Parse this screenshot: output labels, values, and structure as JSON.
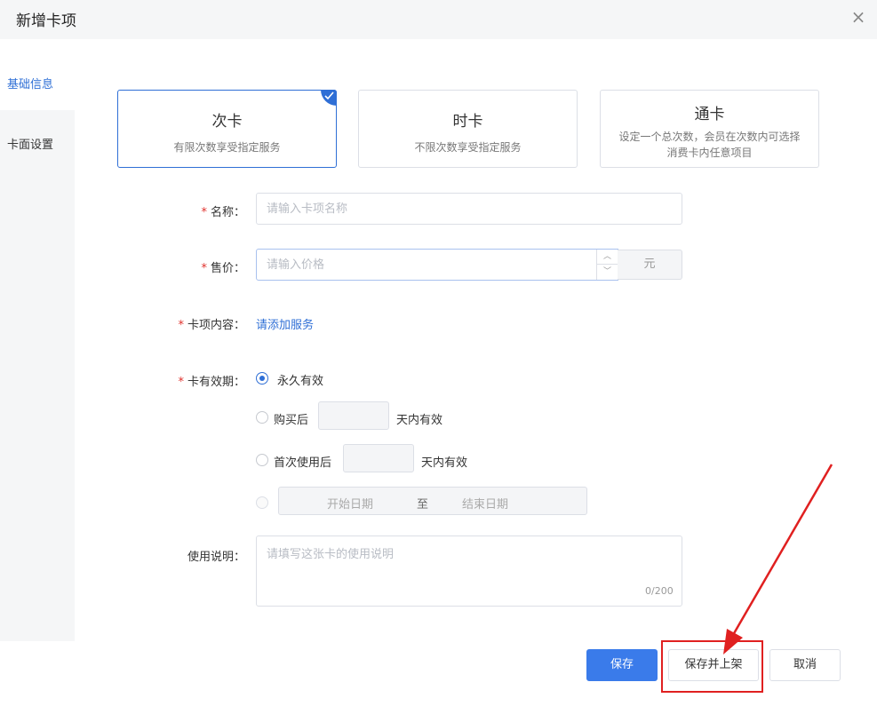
{
  "dialog": {
    "title": "新增卡项",
    "close_icon": "×"
  },
  "sidebar": {
    "items": [
      {
        "label": "基础信息",
        "active": true
      },
      {
        "label": "卡面设置",
        "active": false
      }
    ]
  },
  "card_types": [
    {
      "title": "次卡",
      "desc": "有限次数享受指定服务",
      "selected": true
    },
    {
      "title": "时卡",
      "desc": "不限次数享受指定服务",
      "selected": false
    },
    {
      "title": "通卡",
      "desc": "设定一个总次数，会员在次数内可选择消费卡内任意项目",
      "selected": false
    }
  ],
  "form": {
    "name": {
      "label": "名称：",
      "placeholder": "请输入卡项名称",
      "required": "*"
    },
    "price": {
      "label": "售价：",
      "placeholder": "请输入价格",
      "unit": "元",
      "required": "*"
    },
    "content": {
      "label": "卡项内容：",
      "link": "请添加服务",
      "required": "*"
    },
    "validity": {
      "label": "卡有效期：",
      "required": "*",
      "options": [
        {
          "label": "永久有效",
          "checked": true
        },
        {
          "label": "购买后",
          "suffix": "天内有效"
        },
        {
          "label": "首次使用后",
          "suffix": "天内有效"
        },
        {
          "start": "开始日期",
          "sep": "至",
          "end": "结束日期"
        }
      ]
    },
    "notes": {
      "label": "使用说明：",
      "placeholder": "请填写这张卡的使用说明",
      "counter": "0/200"
    }
  },
  "footer": {
    "save": "保存",
    "save_publish": "保存并上架",
    "cancel": "取消"
  },
  "colors": {
    "accent": "#3a7bea",
    "highlight": "#e02020"
  }
}
